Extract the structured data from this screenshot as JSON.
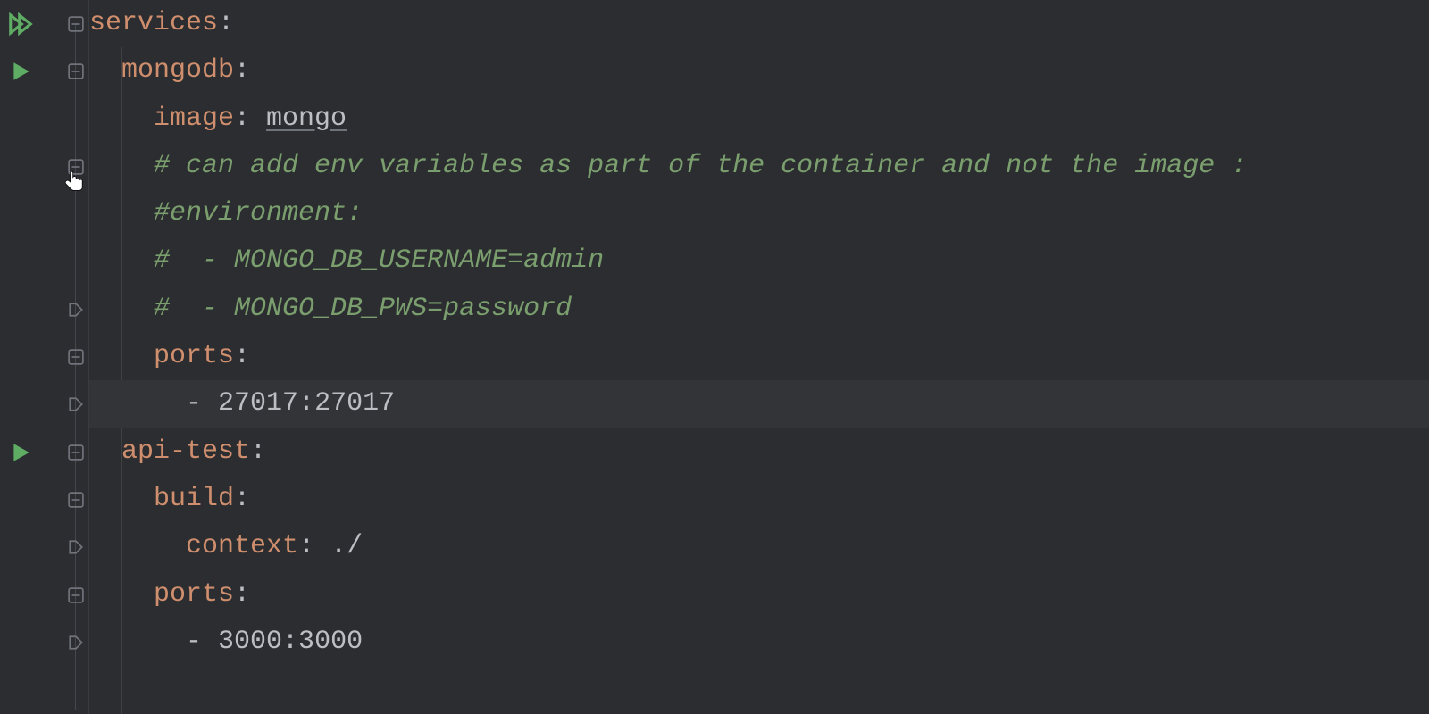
{
  "colors": {
    "bg": "#2b2d30",
    "key": "#cf8e6d",
    "comment": "#7a9e6d",
    "text": "#bcbec4",
    "run": "#5fad65",
    "bulb": "#f2c55c"
  },
  "lines": {
    "l1": {
      "key": "services",
      "colon": ":"
    },
    "l2": {
      "key": "mongodb",
      "colon": ":"
    },
    "l3": {
      "key": "image",
      "colon": ": ",
      "value": "mongo"
    },
    "l4": {
      "comment": "# can add env variables as part of the container and not the image :"
    },
    "l5": {
      "comment": "#environment:"
    },
    "l6": {
      "comment": "#  - MONGO_DB_USERNAME=admin"
    },
    "l7": {
      "comment": "#  - MONGO_DB_PWS=password"
    },
    "l8": {
      "key": "ports",
      "colon": ":"
    },
    "l9": {
      "dash": "- ",
      "value": "27017:27017"
    },
    "l10": {
      "key": "api-test",
      "colon": ":"
    },
    "l11": {
      "key": "build",
      "colon": ":"
    },
    "l12": {
      "key": "context",
      "colon": ": ",
      "value": "./"
    },
    "l13": {
      "key": "ports",
      "colon": ":"
    },
    "l14": {
      "dash": "- ",
      "value": "3000:3000"
    }
  },
  "current_line_index": 9,
  "icons": {
    "run_all": "run-all",
    "run": "run",
    "fold_minus": "fold-minus",
    "fold_end": "fold-end",
    "bulb": "intention-bulb",
    "pointer": "pointer-cursor"
  }
}
